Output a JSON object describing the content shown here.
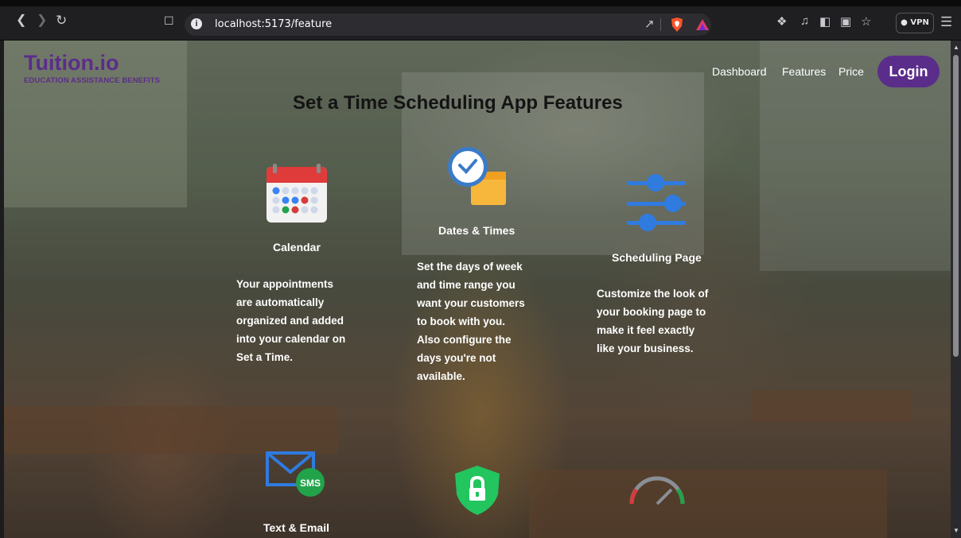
{
  "browser": {
    "url": "localhost:5173/feature",
    "vpn_label": "VPN"
  },
  "site": {
    "brand": "Tuition.io",
    "tagline": "EDUCATION ASSISTANCE BENEFITS",
    "nav": [
      "Dashboard",
      "Features",
      "Price"
    ],
    "login": "Login",
    "page_title": "Set a Time Scheduling App Features"
  },
  "features": [
    {
      "title": "Calendar",
      "icon": "calendar-icon",
      "desc": [
        "Your appointments",
        "are automatically",
        "organized and added",
        "into your calendar on",
        "Set a Time."
      ]
    },
    {
      "title": "Dates & Times",
      "icon": "clock-calendar-icon",
      "desc": [
        "Set the days of week",
        "and time range you",
        "want your customers",
        "to book with you.",
        "Also configure the",
        "days you're not",
        "available."
      ]
    },
    {
      "title": "Scheduling Page",
      "icon": "sliders-icon",
      "desc": [
        "Customize the look of",
        "your booking page to",
        "make it feel exactly",
        "like your business."
      ]
    },
    {
      "title": "Text & Email",
      "icon": "mail-sms-icon",
      "badge": "SMS"
    },
    {
      "icon": "shield-lock-icon"
    },
    {
      "icon": "gauge-icon"
    }
  ],
  "colors": {
    "brand": "#5b2d8a",
    "accent_blue": "#2f7be0",
    "shield_green": "#22c55e"
  }
}
